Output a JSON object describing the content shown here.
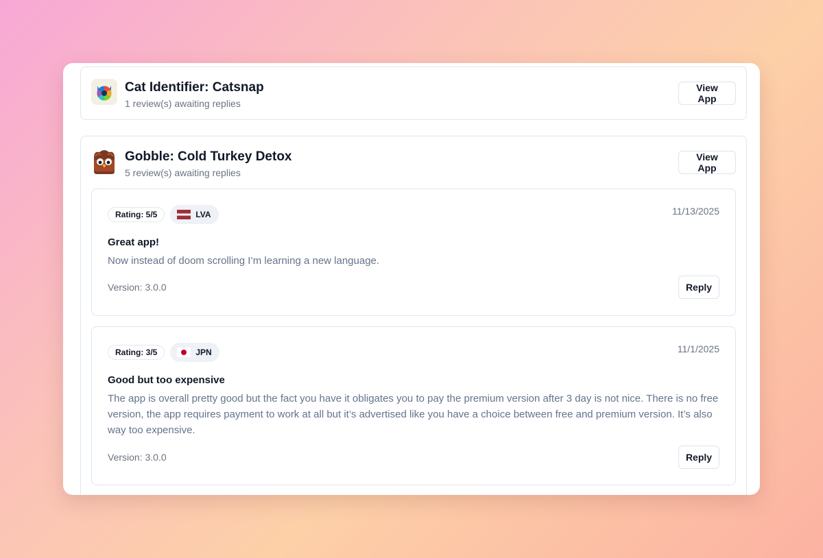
{
  "apps": [
    {
      "name": "Cat Identifier: Catsnap",
      "awaiting": "1 review(s) awaiting replies",
      "view_label": "View App",
      "icon": "catsnap-icon"
    },
    {
      "name": "Gobble: Cold Turkey Detox",
      "awaiting": "5 review(s) awaiting replies",
      "view_label": "View App",
      "icon": "gobble-turkey-icon",
      "reviews": [
        {
          "rating": "Rating: 5/5",
          "country": "LVA",
          "flag": "latvia-flag-icon",
          "date": "11/13/2025",
          "title": "Great app!",
          "body": "Now instead of doom scrolling I’m learning a new language.",
          "version": "Version: 3.0.0",
          "reply_label": "Reply"
        },
        {
          "rating": "Rating: 3/5",
          "country": "JPN",
          "flag": "japan-flag-icon",
          "date": "11/1/2025",
          "title": "Good but too expensive",
          "body": "The app is overall pretty good but the fact you have it obligates you to pay the premium version after 3 day is not nice. There is no free version, the app requires payment to work at all but it’s advertised like you have a choice between free and premium version. It’s also way too expensive.",
          "version": "Version: 3.0.0",
          "reply_label": "Reply"
        }
      ]
    }
  ],
  "colors": {
    "accent_latvia": "#9e3039",
    "accent_japan": "#bc002d",
    "text_primary": "#111827",
    "text_muted": "#64748b"
  }
}
